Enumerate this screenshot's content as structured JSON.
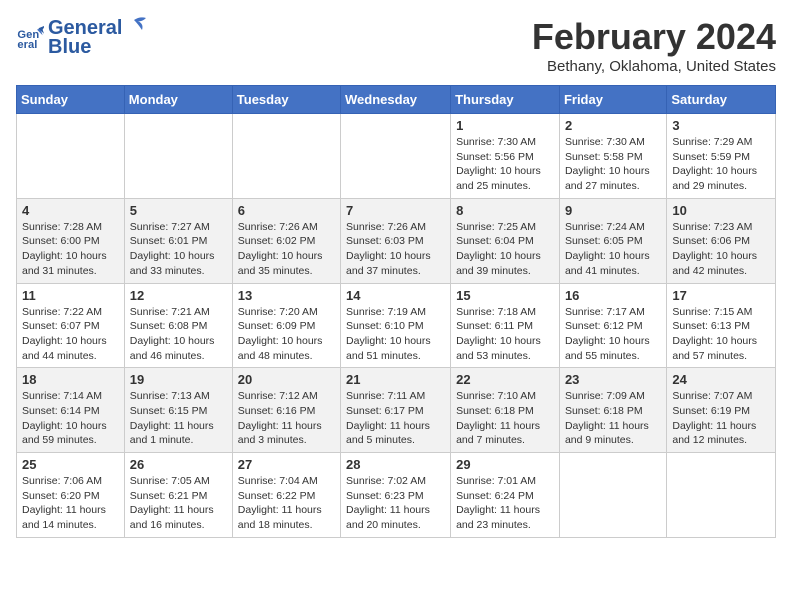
{
  "logo": {
    "line1": "General",
    "line2": "Blue"
  },
  "title": "February 2024",
  "subtitle": "Bethany, Oklahoma, United States",
  "headers": [
    "Sunday",
    "Monday",
    "Tuesday",
    "Wednesday",
    "Thursday",
    "Friday",
    "Saturday"
  ],
  "weeks": [
    [
      {
        "day": "",
        "info": ""
      },
      {
        "day": "",
        "info": ""
      },
      {
        "day": "",
        "info": ""
      },
      {
        "day": "",
        "info": ""
      },
      {
        "day": "1",
        "info": "Sunrise: 7:30 AM\nSunset: 5:56 PM\nDaylight: 10 hours\nand 25 minutes."
      },
      {
        "day": "2",
        "info": "Sunrise: 7:30 AM\nSunset: 5:58 PM\nDaylight: 10 hours\nand 27 minutes."
      },
      {
        "day": "3",
        "info": "Sunrise: 7:29 AM\nSunset: 5:59 PM\nDaylight: 10 hours\nand 29 minutes."
      }
    ],
    [
      {
        "day": "4",
        "info": "Sunrise: 7:28 AM\nSunset: 6:00 PM\nDaylight: 10 hours\nand 31 minutes."
      },
      {
        "day": "5",
        "info": "Sunrise: 7:27 AM\nSunset: 6:01 PM\nDaylight: 10 hours\nand 33 minutes."
      },
      {
        "day": "6",
        "info": "Sunrise: 7:26 AM\nSunset: 6:02 PM\nDaylight: 10 hours\nand 35 minutes."
      },
      {
        "day": "7",
        "info": "Sunrise: 7:26 AM\nSunset: 6:03 PM\nDaylight: 10 hours\nand 37 minutes."
      },
      {
        "day": "8",
        "info": "Sunrise: 7:25 AM\nSunset: 6:04 PM\nDaylight: 10 hours\nand 39 minutes."
      },
      {
        "day": "9",
        "info": "Sunrise: 7:24 AM\nSunset: 6:05 PM\nDaylight: 10 hours\nand 41 minutes."
      },
      {
        "day": "10",
        "info": "Sunrise: 7:23 AM\nSunset: 6:06 PM\nDaylight: 10 hours\nand 42 minutes."
      }
    ],
    [
      {
        "day": "11",
        "info": "Sunrise: 7:22 AM\nSunset: 6:07 PM\nDaylight: 10 hours\nand 44 minutes."
      },
      {
        "day": "12",
        "info": "Sunrise: 7:21 AM\nSunset: 6:08 PM\nDaylight: 10 hours\nand 46 minutes."
      },
      {
        "day": "13",
        "info": "Sunrise: 7:20 AM\nSunset: 6:09 PM\nDaylight: 10 hours\nand 48 minutes."
      },
      {
        "day": "14",
        "info": "Sunrise: 7:19 AM\nSunset: 6:10 PM\nDaylight: 10 hours\nand 51 minutes."
      },
      {
        "day": "15",
        "info": "Sunrise: 7:18 AM\nSunset: 6:11 PM\nDaylight: 10 hours\nand 53 minutes."
      },
      {
        "day": "16",
        "info": "Sunrise: 7:17 AM\nSunset: 6:12 PM\nDaylight: 10 hours\nand 55 minutes."
      },
      {
        "day": "17",
        "info": "Sunrise: 7:15 AM\nSunset: 6:13 PM\nDaylight: 10 hours\nand 57 minutes."
      }
    ],
    [
      {
        "day": "18",
        "info": "Sunrise: 7:14 AM\nSunset: 6:14 PM\nDaylight: 10 hours\nand 59 minutes."
      },
      {
        "day": "19",
        "info": "Sunrise: 7:13 AM\nSunset: 6:15 PM\nDaylight: 11 hours\nand 1 minute."
      },
      {
        "day": "20",
        "info": "Sunrise: 7:12 AM\nSunset: 6:16 PM\nDaylight: 11 hours\nand 3 minutes."
      },
      {
        "day": "21",
        "info": "Sunrise: 7:11 AM\nSunset: 6:17 PM\nDaylight: 11 hours\nand 5 minutes."
      },
      {
        "day": "22",
        "info": "Sunrise: 7:10 AM\nSunset: 6:18 PM\nDaylight: 11 hours\nand 7 minutes."
      },
      {
        "day": "23",
        "info": "Sunrise: 7:09 AM\nSunset: 6:18 PM\nDaylight: 11 hours\nand 9 minutes."
      },
      {
        "day": "24",
        "info": "Sunrise: 7:07 AM\nSunset: 6:19 PM\nDaylight: 11 hours\nand 12 minutes."
      }
    ],
    [
      {
        "day": "25",
        "info": "Sunrise: 7:06 AM\nSunset: 6:20 PM\nDaylight: 11 hours\nand 14 minutes."
      },
      {
        "day": "26",
        "info": "Sunrise: 7:05 AM\nSunset: 6:21 PM\nDaylight: 11 hours\nand 16 minutes."
      },
      {
        "day": "27",
        "info": "Sunrise: 7:04 AM\nSunset: 6:22 PM\nDaylight: 11 hours\nand 18 minutes."
      },
      {
        "day": "28",
        "info": "Sunrise: 7:02 AM\nSunset: 6:23 PM\nDaylight: 11 hours\nand 20 minutes."
      },
      {
        "day": "29",
        "info": "Sunrise: 7:01 AM\nSunset: 6:24 PM\nDaylight: 11 hours\nand 23 minutes."
      },
      {
        "day": "",
        "info": ""
      },
      {
        "day": "",
        "info": ""
      }
    ]
  ]
}
